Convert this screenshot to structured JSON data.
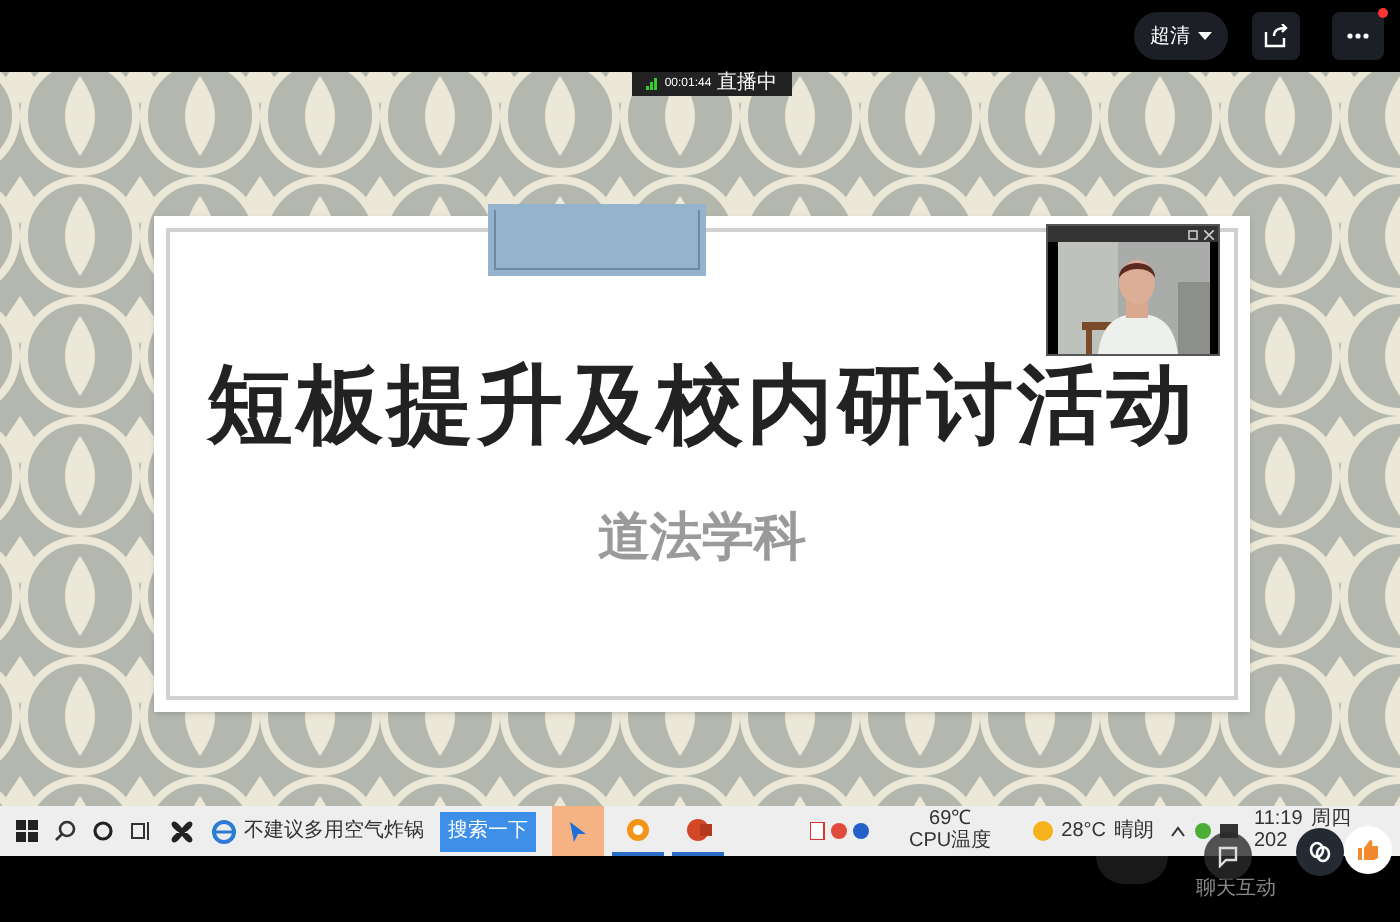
{
  "top_bar": {
    "quality": "超清",
    "has_notification": true
  },
  "live_status": {
    "timer": "00:01:44",
    "status": "直播中"
  },
  "slide": {
    "title": "短板提升及校内研讨活动",
    "subtitle": "道法学科"
  },
  "taskbar": {
    "news": "不建议多用空气炸锅",
    "search_button": "搜索一下",
    "apps": [
      {
        "kind": "arrow",
        "selected": true,
        "running": false
      },
      {
        "kind": "ring",
        "selected": false,
        "running": true
      },
      {
        "kind": "slides",
        "selected": false,
        "running": true
      }
    ],
    "cpu": {
      "temp": "69℃",
      "label": "CPU温度"
    },
    "weather": {
      "temp": "28°C",
      "condition": "晴朗"
    },
    "clock": {
      "time": "11:19",
      "day": "周四",
      "date": "202"
    }
  },
  "bottom_bar": {
    "chat_label": "聊天互动"
  }
}
